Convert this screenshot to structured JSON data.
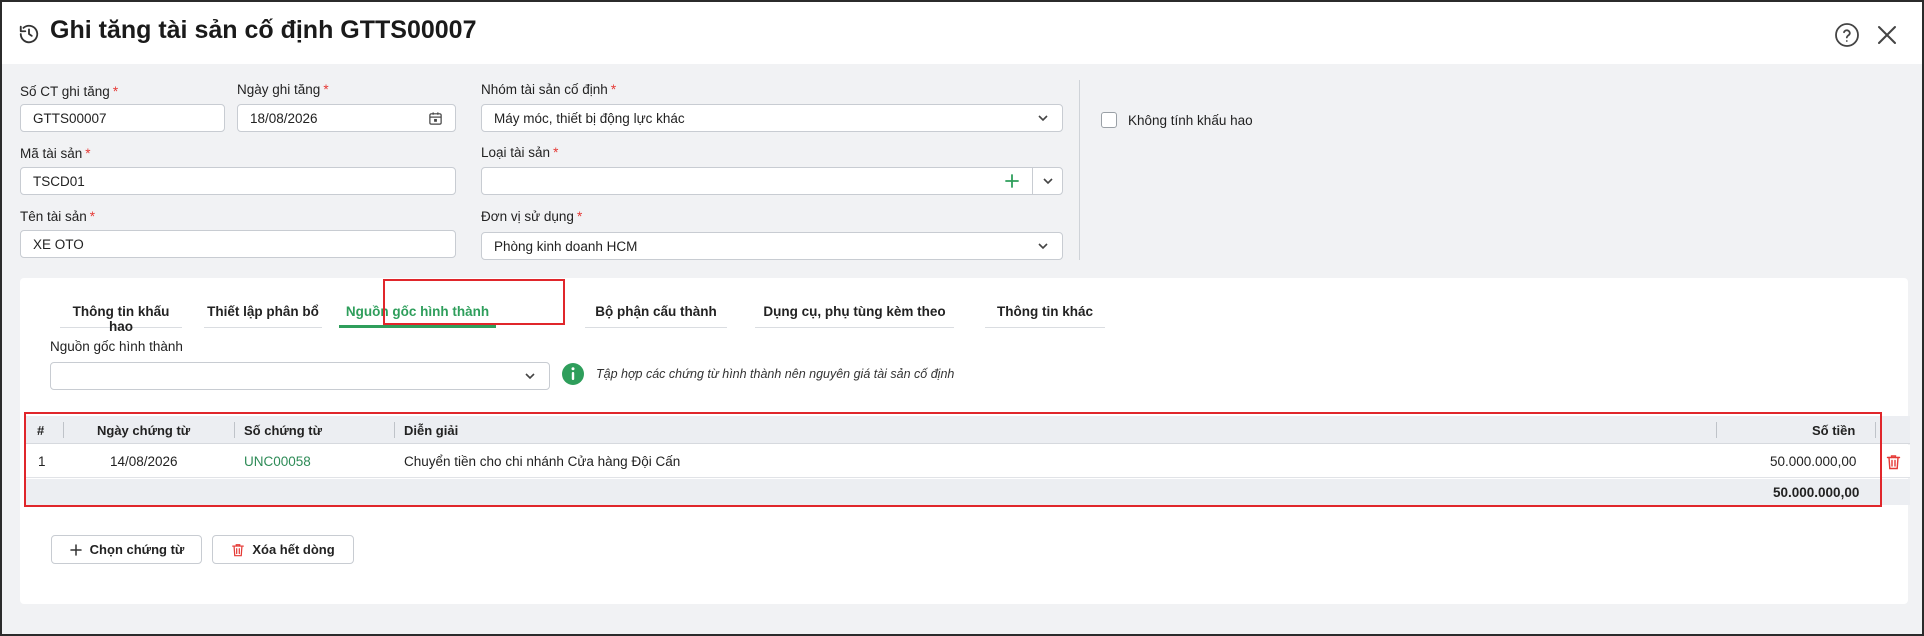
{
  "header": {
    "title": "Ghi tăng tài sản cố định GTTS00007"
  },
  "form": {
    "so_ct": {
      "label": "Số CT ghi tăng",
      "value": "GTTS00007"
    },
    "ngay_ghi_tang": {
      "label": "Ngày ghi tăng",
      "value": "18/08/2026"
    },
    "nhom_tai_san": {
      "label": "Nhóm tài sản cố định",
      "value": "Máy móc, thiết bị động lực khác"
    },
    "ma_tai_san": {
      "label": "Mã tài sản",
      "value": "TSCD01"
    },
    "loai_tai_san": {
      "label": "Loại tài sản",
      "value": ""
    },
    "ten_tai_san": {
      "label": "Tên tài sản",
      "value": "XE OTO"
    },
    "don_vi_su_dung": {
      "label": "Đơn vị sử dụng",
      "value": "Phòng kinh doanh HCM"
    },
    "khong_tinh_khau_hao": {
      "label": "Không tính khấu hao",
      "checked": false
    },
    "required_mark": "*"
  },
  "tabs": [
    {
      "label": "Thông tin khấu hao"
    },
    {
      "label": "Thiết lập phân bổ"
    },
    {
      "label": "Nguồn gốc hình thành",
      "active": true
    },
    {
      "label": "Bộ phận cấu thành"
    },
    {
      "label": "Dụng cụ, phụ tùng kèm theo"
    },
    {
      "label": "Thông tin khác"
    }
  ],
  "origin": {
    "label": "Nguồn gốc hình thành",
    "value": "",
    "info": "Tập hợp các chứng từ hình thành nên nguyên giá tài sản cố định"
  },
  "grid": {
    "headers": {
      "index": "#",
      "date": "Ngày chứng từ",
      "doc_no": "Số chứng từ",
      "desc": "Diễn giải",
      "amount": "Số tiền"
    },
    "rows": [
      {
        "index": "1",
        "date": "14/08/2026",
        "doc_no": "UNC00058",
        "desc": "Chuyển tiền cho chi nhánh Cửa hàng Đội Cấn",
        "amount": "50.000.000,00"
      }
    ],
    "total": "50.000.000,00"
  },
  "buttons": {
    "choose": "Chọn chứng từ",
    "clear": "Xóa hết dòng"
  },
  "colors": {
    "accent_green": "#2e9e5b",
    "highlight_red": "#e0262b",
    "delete_red": "#e53935"
  }
}
